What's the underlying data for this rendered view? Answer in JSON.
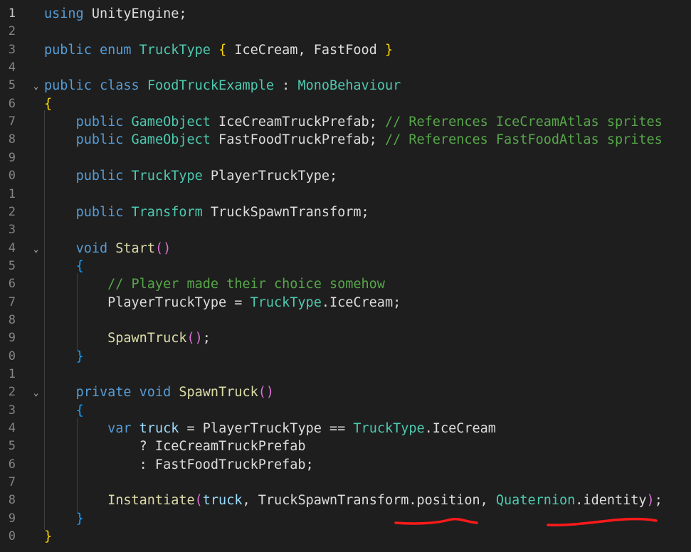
{
  "editor": {
    "lines": [
      {
        "num": "1",
        "tokens": [
          {
            "t": "using",
            "c": "kw"
          },
          {
            "t": " UnityEngine;",
            "c": "id"
          }
        ]
      },
      {
        "num": "2",
        "tokens": []
      },
      {
        "num": "3",
        "tokens": [
          {
            "t": "public",
            "c": "kw"
          },
          {
            "t": " ",
            "c": "id"
          },
          {
            "t": "enum",
            "c": "kw"
          },
          {
            "t": " ",
            "c": "id"
          },
          {
            "t": "TruckType",
            "c": "ty"
          },
          {
            "t": " ",
            "c": "id"
          },
          {
            "t": "{",
            "c": "br1"
          },
          {
            "t": " IceCream, FastFood ",
            "c": "id"
          },
          {
            "t": "}",
            "c": "br1"
          }
        ]
      },
      {
        "num": "4",
        "tokens": []
      },
      {
        "num": "5",
        "fold": true,
        "tokens": [
          {
            "t": "public",
            "c": "kw"
          },
          {
            "t": " ",
            "c": "id"
          },
          {
            "t": "class",
            "c": "kw"
          },
          {
            "t": " ",
            "c": "id"
          },
          {
            "t": "FoodTruckExample",
            "c": "ty"
          },
          {
            "t": " : ",
            "c": "id"
          },
          {
            "t": "MonoBehaviour",
            "c": "ty"
          }
        ]
      },
      {
        "num": "6",
        "tokens": [
          {
            "t": "{",
            "c": "br1"
          }
        ]
      },
      {
        "num": "7",
        "tokens": [
          {
            "t": "    ",
            "c": "id"
          },
          {
            "t": "public",
            "c": "kw"
          },
          {
            "t": " ",
            "c": "id"
          },
          {
            "t": "GameObject",
            "c": "ty"
          },
          {
            "t": " IceCreamTruckPrefab; ",
            "c": "id"
          },
          {
            "t": "// References IceCreamAtlas sprites",
            "c": "cm"
          }
        ]
      },
      {
        "num": "8",
        "tokens": [
          {
            "t": "    ",
            "c": "id"
          },
          {
            "t": "public",
            "c": "kw"
          },
          {
            "t": " ",
            "c": "id"
          },
          {
            "t": "GameObject",
            "c": "ty"
          },
          {
            "t": " FastFoodTruckPrefab; ",
            "c": "id"
          },
          {
            "t": "// References FastFoodAtlas sprites",
            "c": "cm"
          }
        ]
      },
      {
        "num": "9",
        "tokens": []
      },
      {
        "num": "0",
        "tokens": [
          {
            "t": "    ",
            "c": "id"
          },
          {
            "t": "public",
            "c": "kw"
          },
          {
            "t": " ",
            "c": "id"
          },
          {
            "t": "TruckType",
            "c": "ty"
          },
          {
            "t": " PlayerTruckType;",
            "c": "id"
          }
        ]
      },
      {
        "num": "1",
        "tokens": []
      },
      {
        "num": "2",
        "tokens": [
          {
            "t": "    ",
            "c": "id"
          },
          {
            "t": "public",
            "c": "kw"
          },
          {
            "t": " ",
            "c": "id"
          },
          {
            "t": "Transform",
            "c": "ty"
          },
          {
            "t": " TruckSpawnTransform;",
            "c": "id"
          }
        ]
      },
      {
        "num": "3",
        "tokens": []
      },
      {
        "num": "4",
        "fold": true,
        "tokens": [
          {
            "t": "    ",
            "c": "id"
          },
          {
            "t": "void",
            "c": "kw"
          },
          {
            "t": " ",
            "c": "id"
          },
          {
            "t": "Start",
            "c": "fn"
          },
          {
            "t": "()",
            "c": "br2"
          }
        ]
      },
      {
        "num": "5",
        "tokens": [
          {
            "t": "    ",
            "c": "id"
          },
          {
            "t": "{",
            "c": "br3"
          }
        ]
      },
      {
        "num": "6",
        "tokens": [
          {
            "t": "        ",
            "c": "id"
          },
          {
            "t": "// Player made their choice somehow",
            "c": "cm"
          }
        ]
      },
      {
        "num": "7",
        "tokens": [
          {
            "t": "        PlayerTruckType = ",
            "c": "id"
          },
          {
            "t": "TruckType",
            "c": "ty"
          },
          {
            "t": ".IceCream;",
            "c": "id"
          }
        ]
      },
      {
        "num": "8",
        "tokens": []
      },
      {
        "num": "9",
        "tokens": [
          {
            "t": "        ",
            "c": "id"
          },
          {
            "t": "SpawnTruck",
            "c": "fn"
          },
          {
            "t": "()",
            "c": "br2"
          },
          {
            "t": ";",
            "c": "id"
          }
        ]
      },
      {
        "num": "0",
        "tokens": [
          {
            "t": "    ",
            "c": "id"
          },
          {
            "t": "}",
            "c": "br3"
          }
        ]
      },
      {
        "num": "1",
        "tokens": []
      },
      {
        "num": "2",
        "fold": true,
        "tokens": [
          {
            "t": "    ",
            "c": "id"
          },
          {
            "t": "private",
            "c": "kw"
          },
          {
            "t": " ",
            "c": "id"
          },
          {
            "t": "void",
            "c": "kw"
          },
          {
            "t": " ",
            "c": "id"
          },
          {
            "t": "SpawnTruck",
            "c": "fn"
          },
          {
            "t": "()",
            "c": "br2"
          }
        ]
      },
      {
        "num": "3",
        "tokens": [
          {
            "t": "    ",
            "c": "id"
          },
          {
            "t": "{",
            "c": "br3"
          }
        ]
      },
      {
        "num": "4",
        "tokens": [
          {
            "t": "        ",
            "c": "id"
          },
          {
            "t": "var",
            "c": "kw"
          },
          {
            "t": " ",
            "c": "id"
          },
          {
            "t": "truck",
            "c": "loc"
          },
          {
            "t": " = PlayerTruckType == ",
            "c": "id"
          },
          {
            "t": "TruckType",
            "c": "ty"
          },
          {
            "t": ".IceCream",
            "c": "id"
          }
        ]
      },
      {
        "num": "5",
        "tokens": [
          {
            "t": "            ? IceCreamTruckPrefab",
            "c": "id"
          }
        ]
      },
      {
        "num": "6",
        "tokens": [
          {
            "t": "            : FastFoodTruckPrefab;",
            "c": "id"
          }
        ]
      },
      {
        "num": "7",
        "tokens": []
      },
      {
        "num": "8",
        "tokens": [
          {
            "t": "        ",
            "c": "id"
          },
          {
            "t": "Instantiate",
            "c": "fn"
          },
          {
            "t": "(",
            "c": "br2"
          },
          {
            "t": "truck",
            "c": "loc"
          },
          {
            "t": ", TruckSpawnTransform.position, ",
            "c": "id"
          },
          {
            "t": "Quaternion",
            "c": "ty"
          },
          {
            "t": ".identity",
            "c": "id"
          },
          {
            "t": ")",
            "c": "br2"
          },
          {
            "t": ";",
            "c": "id"
          }
        ]
      },
      {
        "num": "9",
        "tokens": [
          {
            "t": "    ",
            "c": "id"
          },
          {
            "t": "}",
            "c": "br3"
          }
        ]
      },
      {
        "num": "0",
        "tokens": [
          {
            "t": "}",
            "c": "br1"
          }
        ]
      }
    ],
    "active_line_index": 0,
    "colors": {
      "background": "#1e1e1e",
      "squiggle": "#ff1a1a"
    }
  }
}
